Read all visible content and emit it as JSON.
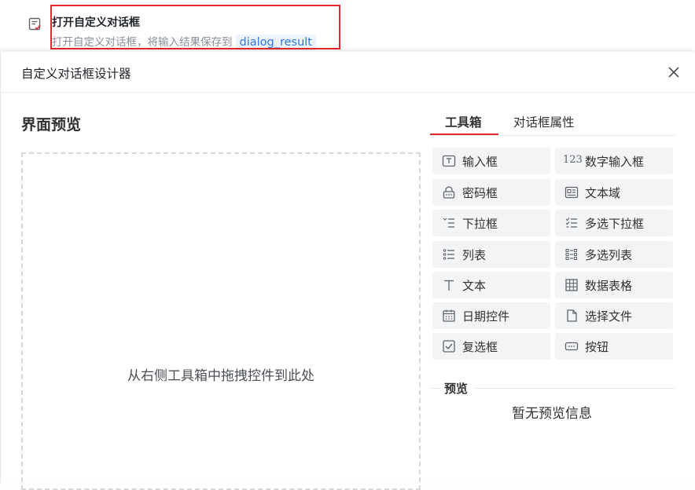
{
  "step": {
    "title": "打开自定义对话框",
    "description": "打开自定义对话框，将输入结果保存到",
    "variable": "dialog_result"
  },
  "dialog": {
    "title": "自定义对话框设计器",
    "preview_heading": "界面预览",
    "drop_hint": "从右侧工具箱中拖拽控件到此处",
    "tabs": [
      {
        "label": "工具箱",
        "active": true
      },
      {
        "label": "对话框属性",
        "active": false
      }
    ],
    "toolbox": [
      {
        "label": "输入框",
        "icon": "input-box-icon"
      },
      {
        "label": "数字输入框",
        "icon": "number-input-icon",
        "glyph": "123"
      },
      {
        "label": "密码框",
        "icon": "password-icon"
      },
      {
        "label": "文本域",
        "icon": "textarea-icon"
      },
      {
        "label": "下拉框",
        "icon": "dropdown-icon"
      },
      {
        "label": "多选下拉框",
        "icon": "multi-dropdown-icon"
      },
      {
        "label": "列表",
        "icon": "list-icon"
      },
      {
        "label": "多选列表",
        "icon": "multi-list-icon"
      },
      {
        "label": "文本",
        "icon": "text-icon"
      },
      {
        "label": "数据表格",
        "icon": "table-icon"
      },
      {
        "label": "日期控件",
        "icon": "calendar-icon"
      },
      {
        "label": "选择文件",
        "icon": "file-icon"
      },
      {
        "label": "复选框",
        "icon": "checkbox-icon"
      },
      {
        "label": "按钮",
        "icon": "button-icon"
      }
    ],
    "preview_section": {
      "label": "预览",
      "empty_text": "暂无预览信息"
    }
  },
  "colors": {
    "highlight": "#e0282e",
    "tab_ink": "#e0282e",
    "variable_tag_bg": "#eef4ff",
    "variable_tag_text": "#2b78e4",
    "tool_bg": "#f3f4f6"
  }
}
